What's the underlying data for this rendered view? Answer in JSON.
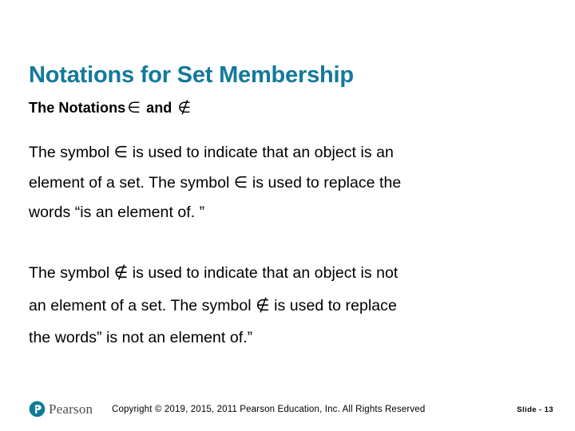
{
  "slide": {
    "title": "Notations for Set Membership",
    "accent_color": "#13799A",
    "background_color": "#FFFFFF",
    "text_color": "#000000"
  },
  "subtitle": {
    "prefix": "The Notations",
    "symbol_element_of": "∈",
    "conjunction": "and",
    "symbol_not_element_of": "∉"
  },
  "paragraphs": {
    "first": {
      "line1_a": "The symbol",
      "line1_sym": "∈",
      "line1_b": "is used to indicate that an object is an",
      "line2_a": "element of a set. The symbol",
      "line2_sym": "∈",
      "line2_b": "is used to replace the",
      "line3": "words “is an element of. ”"
    },
    "second": {
      "line1_a": "The symbol",
      "line1_sym": "∉",
      "line1_b": "is used to indicate that an object is not",
      "line2_a": "an element of a set. The symbol",
      "line2_sym": "∉",
      "line2_b": "is used to replace",
      "line3": "the words” is not an element of.”"
    }
  },
  "footer": {
    "logo_word": "Pearson",
    "logo_letter": "P",
    "logo_color": "#0F7A96",
    "copyright": "Copyright © 2019, 2015, 2011 Pearson Education, Inc. All Rights Reserved",
    "slide_number": "Slide - 13"
  }
}
